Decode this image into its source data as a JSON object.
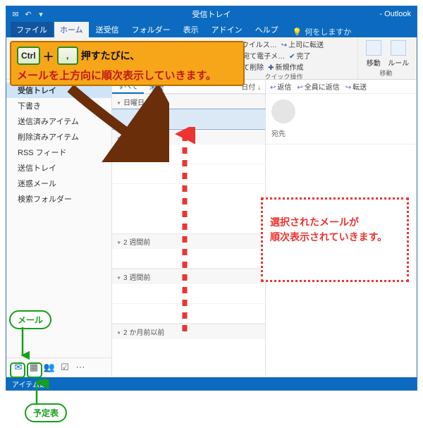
{
  "title": "受信トレイ",
  "appname": "- Outlook",
  "menu": {
    "file": "ファイル",
    "home": "ホーム",
    "sendrecv": "送受信",
    "folder": "フォルダー",
    "view": "表示",
    "addin": "アドイン",
    "help": "ヘルプ",
    "tellme": "何をしますか"
  },
  "quicksteps": {
    "label": "クイック操作",
    "items": [
      [
        "nifty｜ウイルス…",
        "上司に転送"
      ],
      [
        "チーム宛て電子メ…",
        "完了"
      ],
      [
        "返信して削除",
        "新規作成"
      ]
    ]
  },
  "movegroup": {
    "label": "移動",
    "move": "移動",
    "rule": "ルール"
  },
  "nav": {
    "items": [
      "受信トレイ",
      "下書き",
      "送信済みアイテム",
      "削除済みアイテム",
      "RSS フィード",
      "送信トレイ",
      "迷惑メール",
      "検索フォルダー"
    ],
    "selectedIndex": 0
  },
  "list": {
    "tab_all": "すべて",
    "tab_unread": "未読",
    "sort": "日付",
    "sort2": "↓",
    "groups": [
      "日曜日",
      "先週",
      "2 週間前",
      "3 週間前",
      "2 か月前以前"
    ]
  },
  "reading": {
    "reply": "返信",
    "replyall": "全員に返信",
    "forward": "転送",
    "to": "宛先"
  },
  "status": "アイテム数",
  "tip": {
    "key1": "Ctrl",
    "key2": ",",
    "line1": "押すたびに、",
    "line2": "メールを上方向に順次表示していきます。"
  },
  "selbox": {
    "l1": "選択されたメールが",
    "l2": "順次表示されていきます。"
  },
  "labels": {
    "mail": "メール",
    "calendar": "予定表"
  }
}
